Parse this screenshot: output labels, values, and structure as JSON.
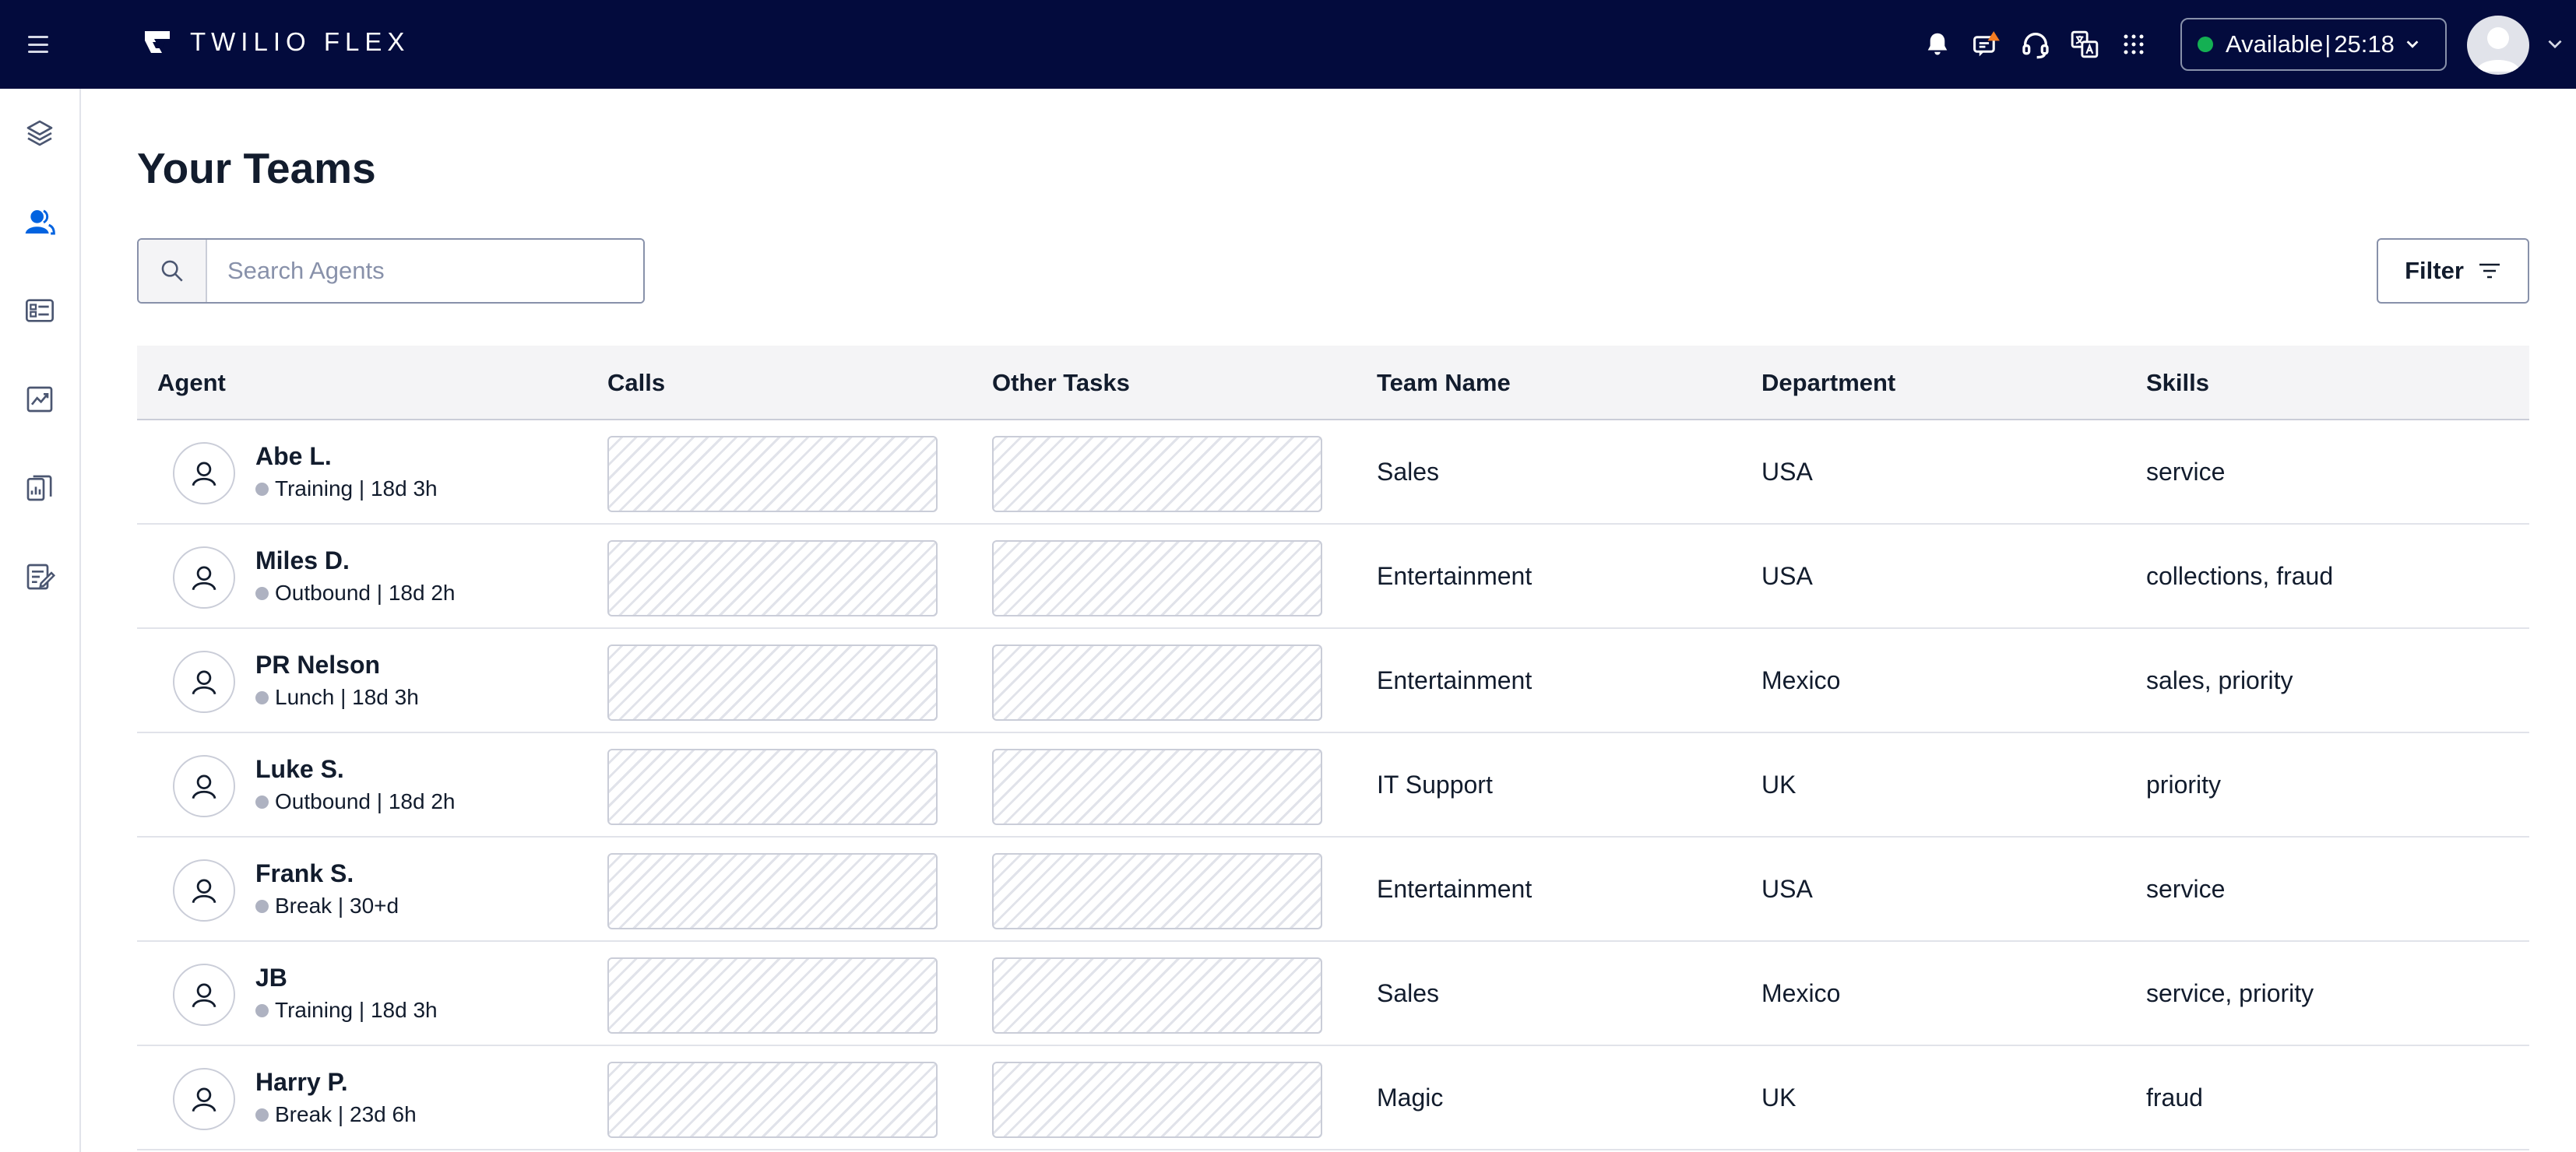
{
  "app": {
    "logo_text": "TWILIO FLEX",
    "brand_bg": "#030b3d"
  },
  "header": {
    "icons": [
      "bell-icon",
      "notification-alert-icon",
      "headset-icon",
      "translate-icon",
      "apps-grid-icon"
    ],
    "status": {
      "label": "Available",
      "timer": "25:18",
      "color": "#14b053"
    }
  },
  "sidebar": {
    "items": [
      {
        "icon": "layers-icon",
        "active": false
      },
      {
        "icon": "agents-icon",
        "active": true
      },
      {
        "icon": "queues-icon",
        "active": false
      },
      {
        "icon": "analytics-icon",
        "active": false
      },
      {
        "icon": "dashboards-icon",
        "active": false
      },
      {
        "icon": "quality-icon",
        "active": false
      }
    ]
  },
  "page": {
    "title": "Your Teams",
    "search_placeholder": "Search Agents",
    "filter_label": "Filter"
  },
  "table": {
    "columns": [
      "Agent",
      "Calls",
      "Other Tasks",
      "Team Name",
      "Department",
      "Skills"
    ],
    "rows": [
      {
        "name": "Abe L.",
        "activity": "Training",
        "duration": "18d 3h",
        "team": "Sales",
        "department": "USA",
        "skills": "service"
      },
      {
        "name": "Miles D.",
        "activity": "Outbound",
        "duration": "18d 2h",
        "team": "Entertainment",
        "department": "USA",
        "skills": "collections, fraud"
      },
      {
        "name": "PR Nelson",
        "activity": "Lunch",
        "duration": "18d 3h",
        "team": "Entertainment",
        "department": "Mexico",
        "skills": "sales, priority"
      },
      {
        "name": "Luke S.",
        "activity": "Outbound",
        "duration": "18d 2h",
        "team": "IT Support",
        "department": "UK",
        "skills": "priority"
      },
      {
        "name": "Frank S.",
        "activity": "Break",
        "duration": "30+d",
        "team": "Entertainment",
        "department": "USA",
        "skills": "service"
      },
      {
        "name": "JB",
        "activity": "Training",
        "duration": "18d 3h",
        "team": "Sales",
        "department": "Mexico",
        "skills": "service, priority"
      },
      {
        "name": "Harry P.",
        "activity": "Break",
        "duration": "23d 6h",
        "team": "Magic",
        "department": "UK",
        "skills": "fraud"
      }
    ]
  }
}
